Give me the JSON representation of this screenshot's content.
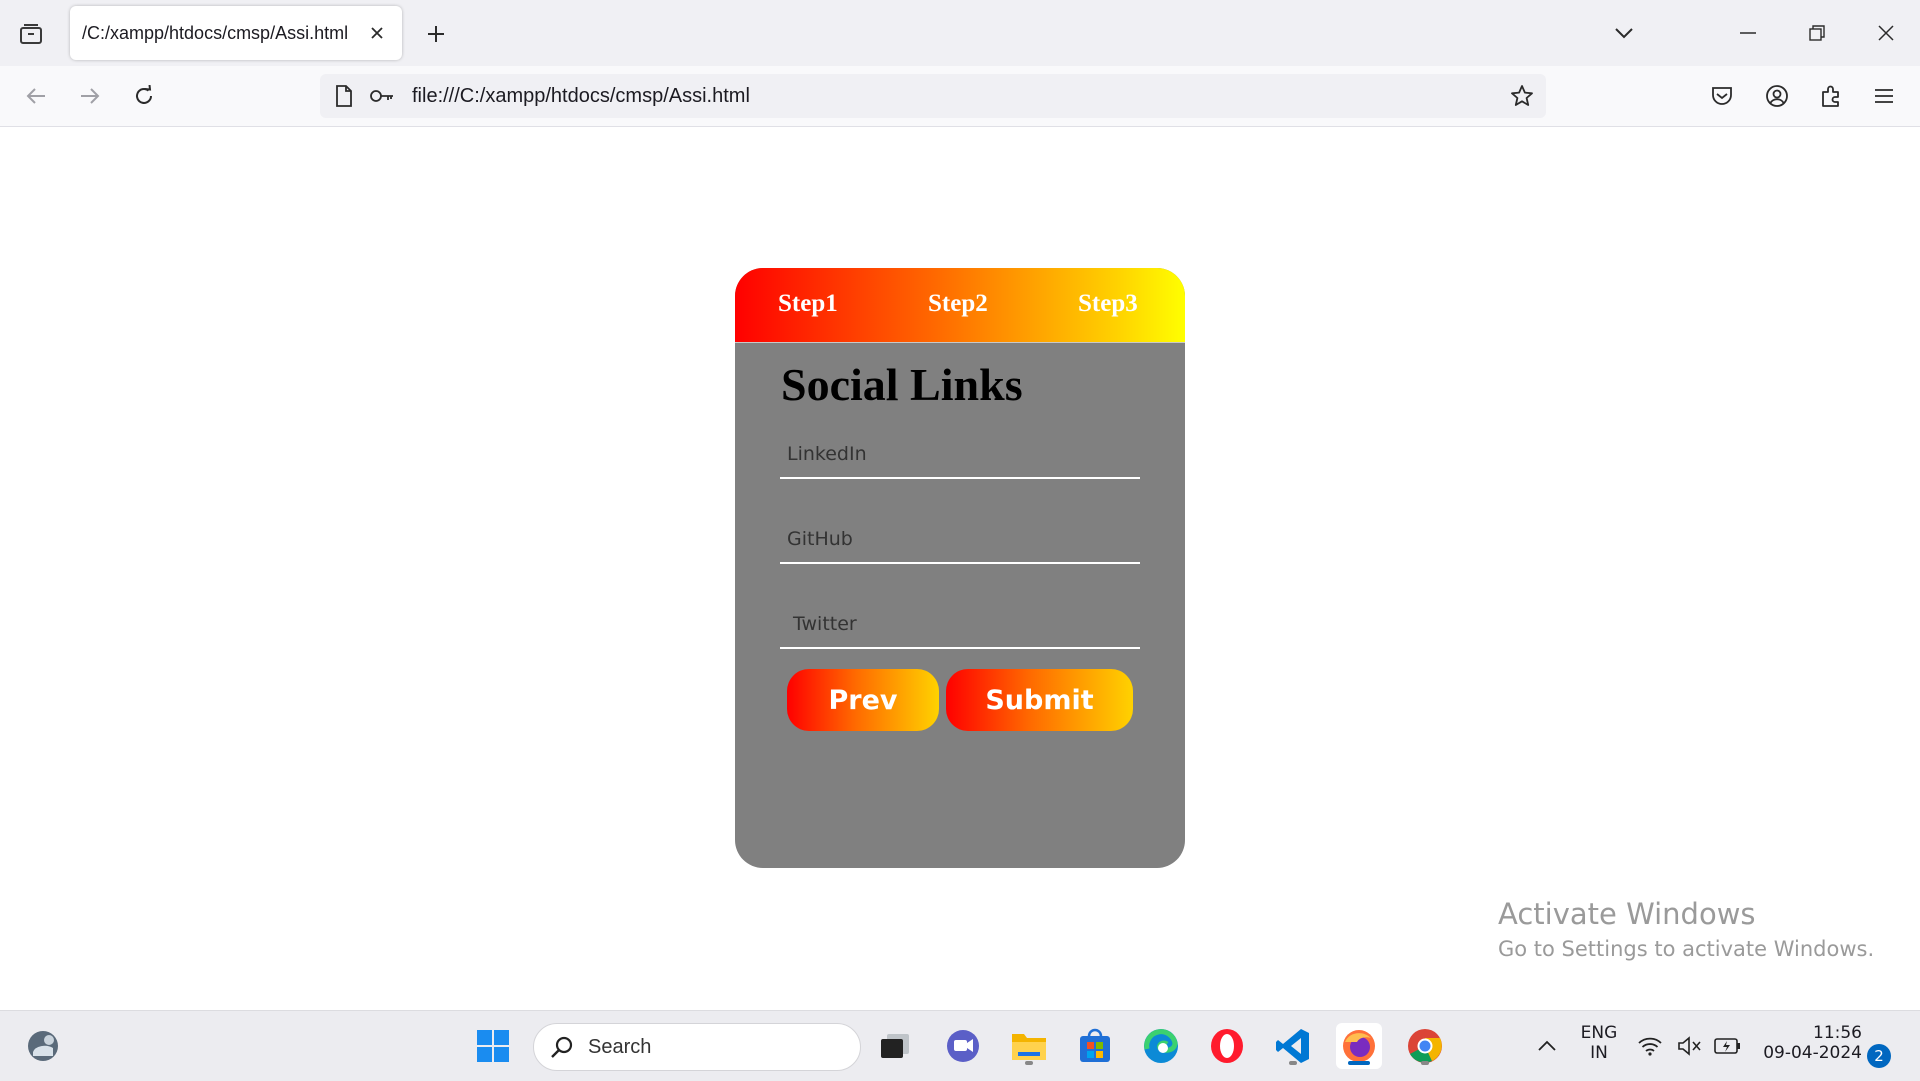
{
  "browser": {
    "tab_title": "/C:/xampp/htdocs/cmsp/Assi.html",
    "url": "file:///C:/xampp/htdocs/cmsp/Assi.html"
  },
  "page": {
    "steps": [
      "Step1",
      "Step2",
      "Step3"
    ],
    "title": "Social Links",
    "fields": {
      "linkedin_placeholder": "LinkedIn",
      "github_placeholder": "GitHub",
      "twitter_placeholder": " Twitter"
    },
    "prev_label": "Prev",
    "submit_label": "Submit",
    "gradient_colors": [
      "#ff0000",
      "#ff6a00",
      "#ffd200",
      "#ffff00"
    ],
    "card_color": "#808080"
  },
  "watermark": {
    "line1": "Activate Windows",
    "line2": "Go to Settings to activate Windows."
  },
  "taskbar": {
    "search_placeholder": "Search",
    "language": "ENG",
    "region": "IN",
    "time": "11:56",
    "date": "09-04-2024",
    "notification_count": "2",
    "apps": [
      "widgets-icon",
      "windows-start-icon",
      "task-view-icon",
      "meet-icon",
      "file-explorer-icon",
      "store-icon",
      "edge-icon",
      "opera-icon",
      "vscode-icon",
      "firefox-icon",
      "chrome-icon"
    ]
  }
}
